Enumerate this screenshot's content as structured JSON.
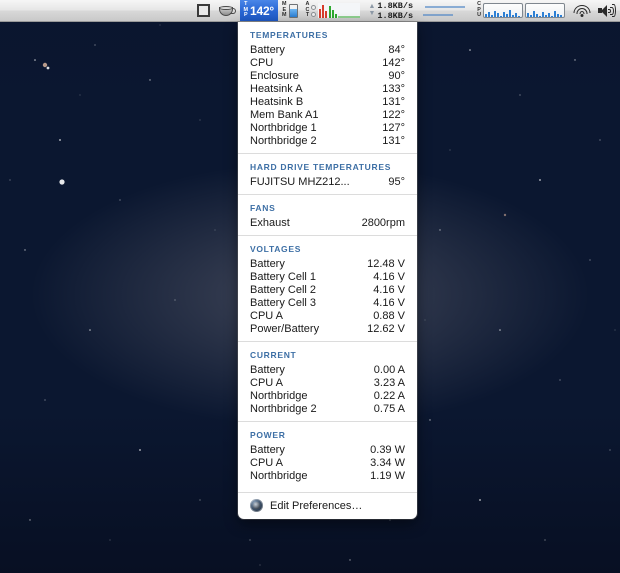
{
  "menubar": {
    "items": [
      {
        "name": "window-icon",
        "icon": "square-icon",
        "label": ""
      },
      {
        "name": "caffeine",
        "icon": "coffee-cup-icon",
        "label": ""
      }
    ],
    "temp_widget": {
      "label": "TMP",
      "value": "142°",
      "selected": true
    },
    "mem_widget": {
      "label": "MEM"
    },
    "act_widget": {
      "label": "ACT"
    },
    "net_widget": {
      "up_speed": "1.8KB/s",
      "down_speed": "1.8KB/s"
    },
    "cpu_widget": {
      "label": "CPU"
    },
    "wifi_icon": "wifi-icon",
    "volume_icon": "speaker-icon"
  },
  "panel": {
    "sections": [
      {
        "title": "TEMPERATURES",
        "rows": [
          {
            "key": "Battery",
            "value": "84°"
          },
          {
            "key": "CPU",
            "value": "142°"
          },
          {
            "key": "Enclosure",
            "value": "90°"
          },
          {
            "key": "Heatsink A",
            "value": "133°"
          },
          {
            "key": "Heatsink B",
            "value": "131°"
          },
          {
            "key": "Mem Bank A1",
            "value": "122°"
          },
          {
            "key": "Northbridge 1",
            "value": "127°"
          },
          {
            "key": "Northbridge 2",
            "value": "131°"
          }
        ]
      },
      {
        "title": "HARD DRIVE TEMPERATURES",
        "rows": [
          {
            "key": "FUJITSU MHZ212...",
            "value": "95°"
          }
        ]
      },
      {
        "title": "FANS",
        "rows": [
          {
            "key": "Exhaust",
            "value": "2800rpm"
          }
        ]
      },
      {
        "title": "VOLTAGES",
        "rows": [
          {
            "key": "Battery",
            "value": "12.48 V"
          },
          {
            "key": "Battery Cell 1",
            "value": "4.16 V"
          },
          {
            "key": "Battery Cell 2",
            "value": "4.16 V"
          },
          {
            "key": "Battery Cell 3",
            "value": "4.16 V"
          },
          {
            "key": "CPU A",
            "value": "0.88 V"
          },
          {
            "key": "Power/Battery",
            "value": "12.62 V"
          }
        ]
      },
      {
        "title": "CURRENT",
        "rows": [
          {
            "key": "Battery",
            "value": "0.00 A"
          },
          {
            "key": "CPU A",
            "value": "3.23 A"
          },
          {
            "key": "Northbridge",
            "value": "0.22 A"
          },
          {
            "key": "Northbridge 2",
            "value": "0.75 A"
          }
        ]
      },
      {
        "title": "POWER",
        "rows": [
          {
            "key": "Battery",
            "value": "0.39 W"
          },
          {
            "key": "CPU A",
            "value": "3.34 W"
          },
          {
            "key": "Northbridge",
            "value": "1.19 W"
          }
        ]
      }
    ],
    "footer": {
      "icon": "preferences-icon",
      "label": "Edit Preferences…"
    }
  },
  "colors": {
    "section_title": "#3d6fa5",
    "selected_menu": "#2a67d4",
    "panel_bg": "#ffffff"
  }
}
